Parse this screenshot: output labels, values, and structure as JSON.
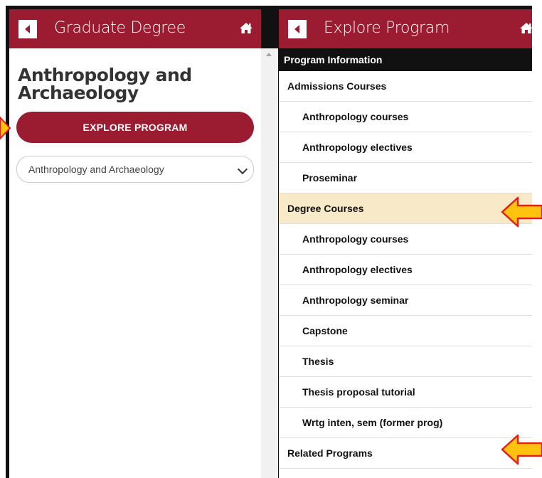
{
  "left_panel": {
    "header_title": "Graduate Degree",
    "program_title": "Anthropology and Archaeology",
    "explore_button": "EXPLORE PROGRAM",
    "program_select_value": "Anthropology and Archaeology"
  },
  "right_panel": {
    "header_title": "Explore Program",
    "list_header": "Program Information",
    "items": [
      {
        "label": "Admissions Courses",
        "kind": "section"
      },
      {
        "label": "Anthropology courses",
        "kind": "sub"
      },
      {
        "label": "Anthropology electives",
        "kind": "sub"
      },
      {
        "label": "Proseminar",
        "kind": "sub"
      },
      {
        "label": "Degree Courses",
        "kind": "section",
        "highlighted": true
      },
      {
        "label": "Anthropology courses",
        "kind": "sub"
      },
      {
        "label": "Anthropology electives",
        "kind": "sub"
      },
      {
        "label": "Anthropology seminar",
        "kind": "sub"
      },
      {
        "label": "Capstone",
        "kind": "sub"
      },
      {
        "label": "Thesis",
        "kind": "sub"
      },
      {
        "label": "Thesis proposal tutorial",
        "kind": "sub"
      },
      {
        "label": "Wrtg inten, sem (former prog)",
        "kind": "sub"
      },
      {
        "label": "Related Programs",
        "kind": "section"
      }
    ]
  },
  "colors": {
    "brand": "#9b1b30",
    "highlight": "#f8e9c8",
    "arrow_fill": "#ffc20e",
    "arrow_stroke": "#e0201b"
  },
  "icons": {
    "back": "back-arrow-icon",
    "home": "home-icon",
    "dropdown": "chevron-down-icon"
  }
}
